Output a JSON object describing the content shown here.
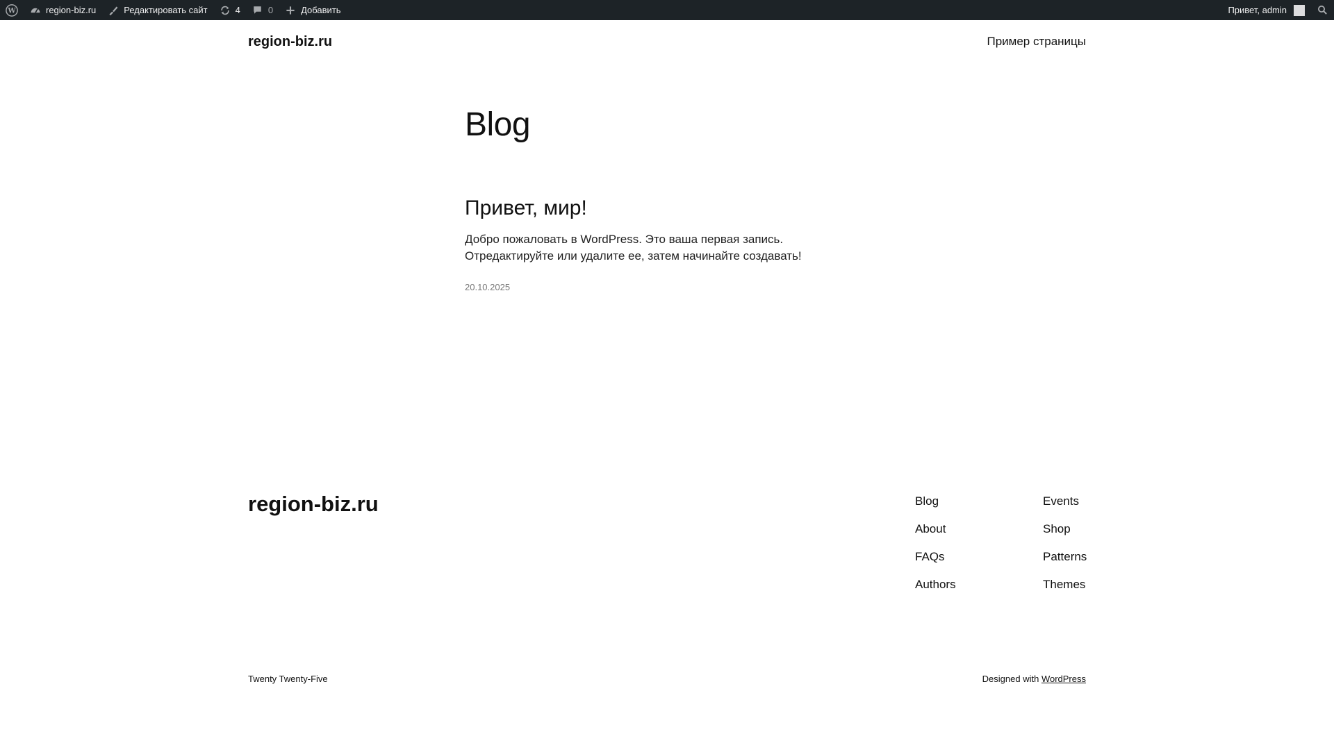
{
  "adminbar": {
    "site_name": "region-biz.ru",
    "edit_site": "Редактировать сайт",
    "updates_count": "4",
    "comments_count": "0",
    "add_new": "Добавить",
    "greeting": "Привет, admin"
  },
  "header": {
    "site_title": "region-biz.ru",
    "nav_item": "Пример страницы"
  },
  "main": {
    "page_title": "Blog",
    "post": {
      "title": "Привет, мир!",
      "excerpt": "Добро пожаловать в WordPress. Это ваша первая запись. Отредактируйте или удалите ее, затем начинайте создавать!",
      "date": "20.10.2025"
    }
  },
  "footer": {
    "site_title": "region-biz.ru",
    "nav_col1": [
      "Blog",
      "About",
      "FAQs",
      "Authors"
    ],
    "nav_col2": [
      "Events",
      "Shop",
      "Patterns",
      "Themes"
    ],
    "theme_name": "Twenty Twenty-Five",
    "designed_with": "Designed with",
    "wordpress_link": "WordPress"
  },
  "colors": {
    "adminbar_bg": "#1d2327",
    "text": "#111111",
    "muted": "#777777"
  }
}
